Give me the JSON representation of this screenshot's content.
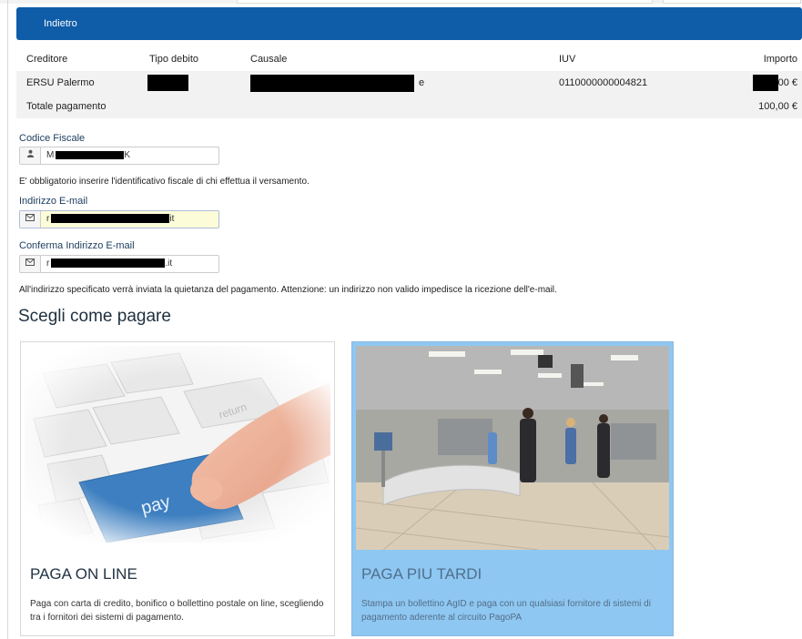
{
  "header": {
    "back_label": "Indietro"
  },
  "table": {
    "columns": [
      "Creditore",
      "Tipo debito",
      "Causale",
      "IUV",
      "Importo"
    ],
    "rows": [
      {
        "creditore": "ERSU Palermo",
        "tipo_debito": "",
        "causale": "e",
        "iuv": "0110000000004821",
        "importo": "00 €"
      }
    ],
    "total_label": "Totale pagamento",
    "total_value": "100,00 €"
  },
  "form": {
    "cf_label": "Codice Fiscale",
    "cf_prefix": "M",
    "cf_suffix": "K",
    "cf_note": "E' obbligatorio inserire l'identificativo fiscale di chi effettua il versamento.",
    "email_label": "Indirizzo E-mail",
    "email_prefix": "r",
    "email_suffix": "it",
    "confirm_label": "Conferma Indirizzo E-mail",
    "confirm_prefix": "r",
    "confirm_suffix": ".it",
    "email_note": "All'indirizzo specificato verrà inviata la quietanza del pagamento. Attenzione: un indirizzo non valido impedisce la ricezione dell'e-mail."
  },
  "section_title": "Scegli come pagare",
  "options": [
    {
      "title": "PAGA ON LINE",
      "description": "Paga con carta di credito, bonifico o bollettino postale on line, scegliendo tra i fornitori dei sistemi di pagamento.",
      "key_text": "pay",
      "return_text": "return"
    },
    {
      "title": "PAGA PIU TARDI",
      "description": "Stampa un bollettino AgID e paga con un qualsiasi fornitore di sistemi di pagamento aderente al circuito PagoPA"
    }
  ],
  "colors": {
    "header": "#0f5ca8",
    "selected_card": "#8ec7f2",
    "key_blue": "#3d7fc0"
  }
}
